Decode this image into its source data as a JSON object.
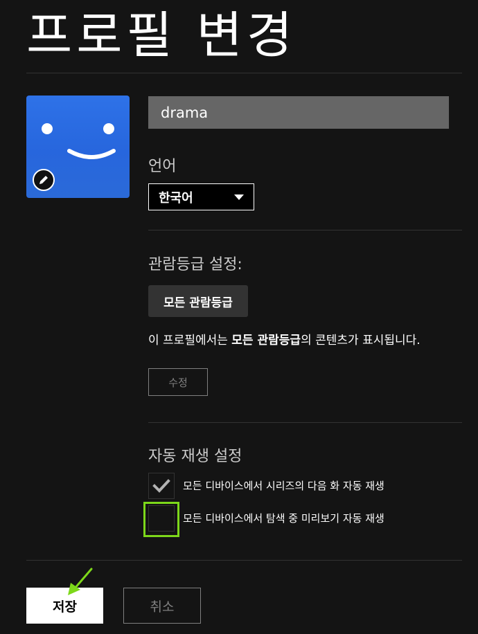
{
  "page": {
    "title": "프로필 변경"
  },
  "profile": {
    "name_value": "drama",
    "avatar_color": "#2e72e8"
  },
  "language": {
    "label": "언어",
    "selected": "한국어"
  },
  "maturity": {
    "label": "관람등급 설정:",
    "chip": "모든 관람등급",
    "desc_prefix": "이 프로필에서는 ",
    "desc_bold": "모든 관람등급",
    "desc_suffix": "의 콘텐츠가 표시됩니다.",
    "edit_button": "수정"
  },
  "autoplay": {
    "label": "자동 재생 설정",
    "options": [
      {
        "label": "모든 디바이스에서 시리즈의 다음 화 자동 재생",
        "checked": true
      },
      {
        "label": "모든 디바이스에서 탐색 중 미리보기 자동 재생",
        "checked": false
      }
    ]
  },
  "actions": {
    "save": "저장",
    "cancel": "취소"
  },
  "annotation": {
    "highlight_color": "#7dd81a"
  },
  "icons": {
    "edit": "pencil-icon",
    "dropdown": "caret-down-icon",
    "check": "checkmark-icon",
    "pointer": "arrow-icon"
  }
}
